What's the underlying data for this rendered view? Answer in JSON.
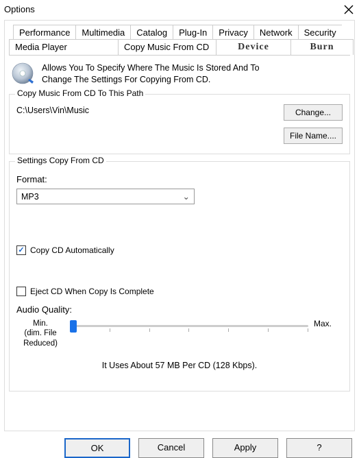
{
  "window": {
    "title": "Options"
  },
  "tabs_row1": [
    "Performance",
    "Multimedia",
    "Catalog",
    "Plug-In",
    "Privacy",
    "Network",
    "Security"
  ],
  "tabs_row2": {
    "media_player": "Media Player",
    "copy_music": "Copy Music From CD",
    "device": "Device",
    "burn": "Burn"
  },
  "intro": {
    "line1": "Allows You To Specify Where The Music Is Stored And To",
    "line2": "Change The Settings For Copying From CD."
  },
  "path_group": {
    "legend": "Copy Music From CD To This Path",
    "path": "C:\\Users\\Vin\\Music",
    "change_btn": "Change...",
    "filename_btn": "File Name...."
  },
  "settings_group": {
    "legend": "Settings Copy From CD",
    "format_label": "Format:",
    "format_value": "MP3",
    "copy_auto": "Copy CD Automatically",
    "eject": "Eject CD When Copy Is Complete",
    "quality_label": "Audio Quality:",
    "min_label_1": "Min.",
    "min_label_2": "(dim. File",
    "min_label_3": "Reduced)",
    "max_label": "Max.",
    "usage": "It Uses About 57 MB Per CD (128 Kbps)."
  },
  "footer": {
    "ok": "OK",
    "cancel": "Cancel",
    "apply": "Apply",
    "help": "?"
  }
}
